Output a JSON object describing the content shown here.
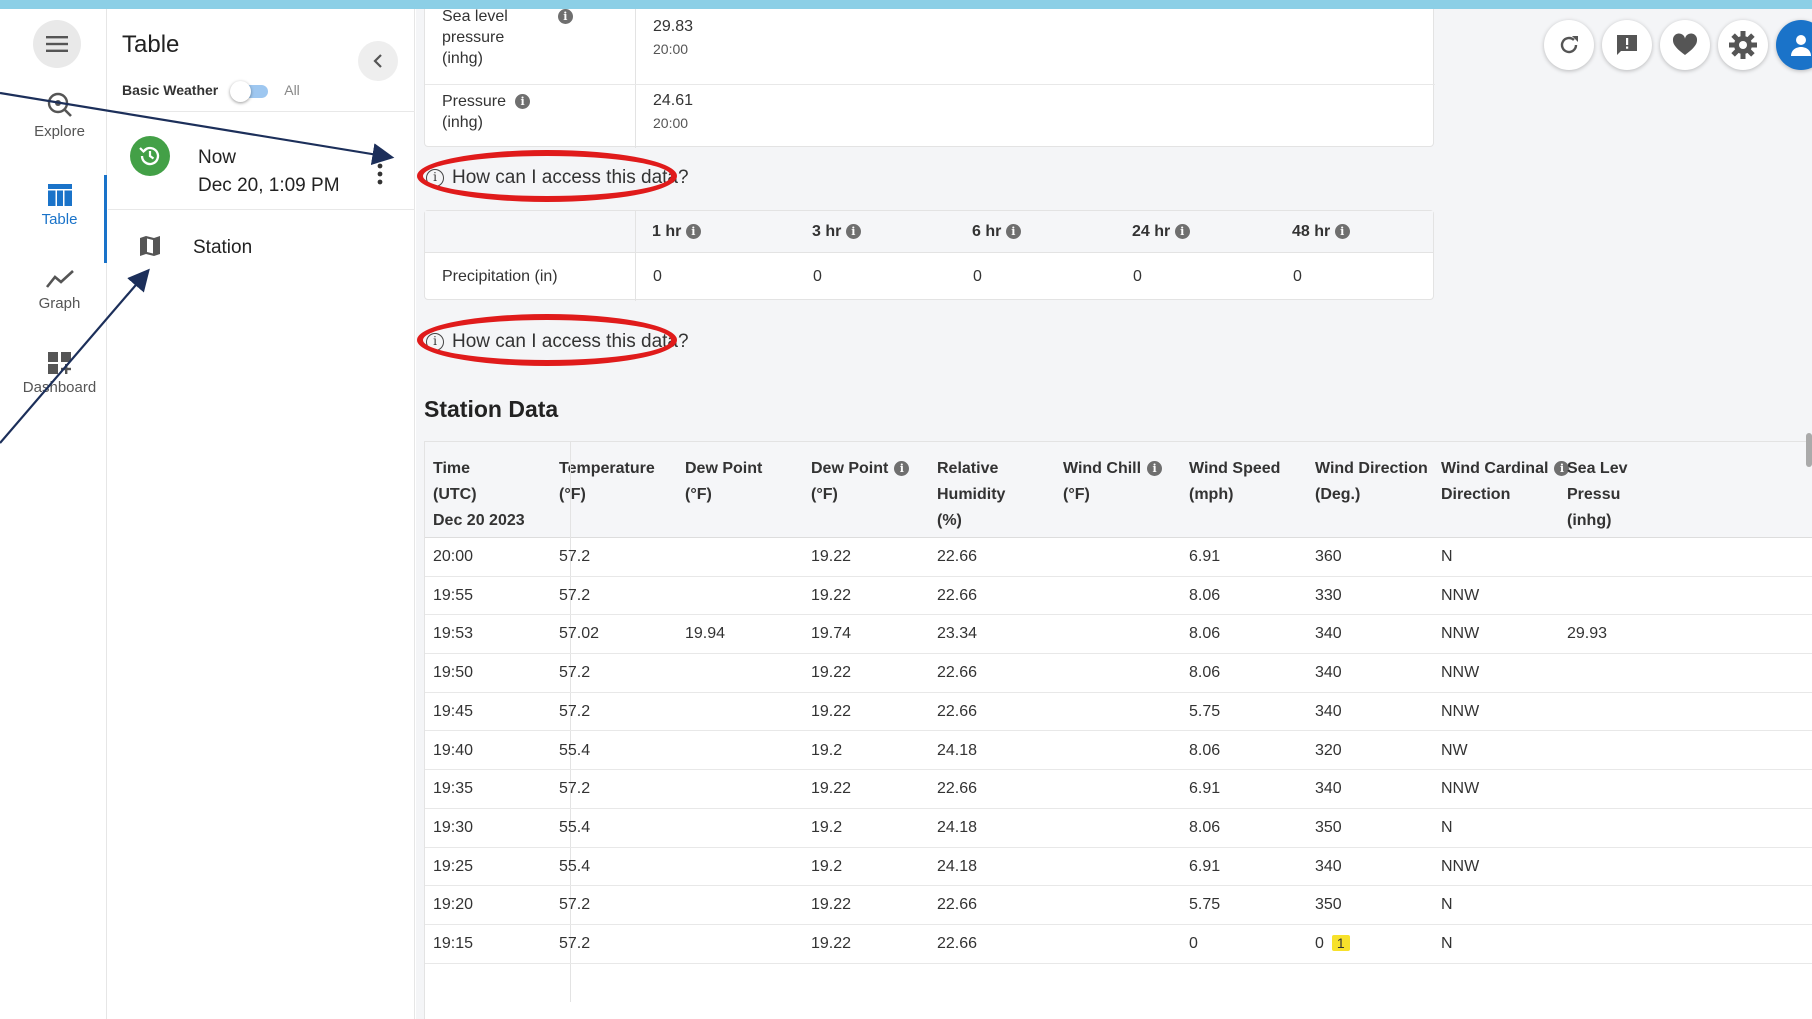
{
  "rail": {
    "items": [
      {
        "label": "Explore",
        "icon": "explore-icon"
      },
      {
        "label": "Table",
        "icon": "table-icon"
      },
      {
        "label": "Graph",
        "icon": "graph-icon"
      },
      {
        "label": "Dashboard",
        "icon": "dashboard-icon"
      }
    ]
  },
  "panel": {
    "title": "Table",
    "toggle_left": "Basic Weather",
    "toggle_right": "All",
    "now_label": "Now",
    "now_time": "Dec 20, 1:09 PM",
    "station_label": "Station"
  },
  "summary": {
    "rows": [
      {
        "label_lines": [
          "Sea level",
          "pressure",
          "(inhg)"
        ],
        "value": "29.83",
        "time": "20:00"
      },
      {
        "label_lines": [
          "Pressure",
          "(inhg)"
        ],
        "value": "24.61",
        "time": "20:00"
      }
    ]
  },
  "access_link": "How can I access this data?",
  "precip": {
    "headers": [
      "1 hr",
      "3 hr",
      "6 hr",
      "24 hr",
      "48 hr"
    ],
    "row_label": "Precipitation (in)",
    "values": [
      "0",
      "0",
      "0",
      "0",
      "0"
    ]
  },
  "station_data": {
    "title": "Station Data",
    "columns": [
      {
        "lines": [
          "Time",
          "(UTC)",
          "Dec 20 2023"
        ],
        "info": false
      },
      {
        "lines": [
          "Temperature",
          "(°F)"
        ],
        "info": false
      },
      {
        "lines": [
          "Dew Point",
          "(°F)"
        ],
        "info": false
      },
      {
        "lines": [
          "Dew Point",
          "(°F)"
        ],
        "info": true
      },
      {
        "lines": [
          "Relative",
          "Humidity",
          "(%)"
        ],
        "info": false
      },
      {
        "lines": [
          "Wind Chill",
          "(°F)"
        ],
        "info": true
      },
      {
        "lines": [
          "Wind Speed",
          "(mph)"
        ],
        "info": false
      },
      {
        "lines": [
          "Wind Direction",
          "(Deg.)"
        ],
        "info": false
      },
      {
        "lines": [
          "Wind Cardinal",
          "Direction"
        ],
        "info": true
      },
      {
        "lines": [
          "Sea Lev",
          "Pressu",
          "(inhg)"
        ],
        "info": false
      }
    ],
    "rows": [
      [
        "20:00",
        "57.2",
        "",
        "19.22",
        "22.66",
        "",
        "6.91",
        "360",
        "N",
        ""
      ],
      [
        "19:55",
        "57.2",
        "",
        "19.22",
        "22.66",
        "",
        "8.06",
        "330",
        "NNW",
        ""
      ],
      [
        "19:53",
        "57.02",
        "19.94",
        "19.74",
        "23.34",
        "",
        "8.06",
        "340",
        "NNW",
        "29.93"
      ],
      [
        "19:50",
        "57.2",
        "",
        "19.22",
        "22.66",
        "",
        "8.06",
        "340",
        "NNW",
        ""
      ],
      [
        "19:45",
        "57.2",
        "",
        "19.22",
        "22.66",
        "",
        "5.75",
        "340",
        "NNW",
        ""
      ],
      [
        "19:40",
        "55.4",
        "",
        "19.2",
        "24.18",
        "",
        "8.06",
        "320",
        "NW",
        ""
      ],
      [
        "19:35",
        "57.2",
        "",
        "19.22",
        "22.66",
        "",
        "6.91",
        "340",
        "NNW",
        ""
      ],
      [
        "19:30",
        "55.4",
        "",
        "19.2",
        "24.18",
        "",
        "8.06",
        "350",
        "N",
        ""
      ],
      [
        "19:25",
        "55.4",
        "",
        "19.2",
        "24.18",
        "",
        "6.91",
        "340",
        "NNW",
        ""
      ],
      [
        "19:20",
        "57.2",
        "",
        "19.22",
        "22.66",
        "",
        "5.75",
        "350",
        "N",
        ""
      ],
      [
        "19:15",
        "57.2",
        "",
        "19.22",
        "22.66",
        "",
        "0",
        "0",
        "N",
        ""
      ]
    ],
    "badge": "1"
  },
  "colors": {
    "accent": "#1a73c9",
    "now_green": "#43a047",
    "annotation_red": "#e01b1b",
    "highlight": "#f7e12b"
  }
}
